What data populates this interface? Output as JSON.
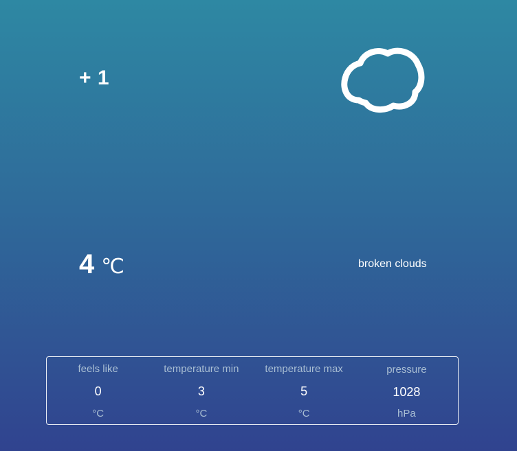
{
  "weather": {
    "offset": "+ 1",
    "icon": "broken-clouds-icon",
    "temperature": "4",
    "temperature_unit": "℃",
    "description": "broken clouds"
  },
  "stats": [
    {
      "label": "feels like",
      "value": "0",
      "unit": "°C"
    },
    {
      "label": "temperature min",
      "value": "3",
      "unit": "°C"
    },
    {
      "label": "temperature max",
      "value": "5",
      "unit": "°C"
    },
    {
      "label": "pressure",
      "value": "1028",
      "unit": "hPa"
    }
  ],
  "colors": {
    "background_top": "#2e88a3",
    "background_bottom": "#30438f",
    "text": "#ffffff",
    "muted_text": "#a9bed3"
  }
}
